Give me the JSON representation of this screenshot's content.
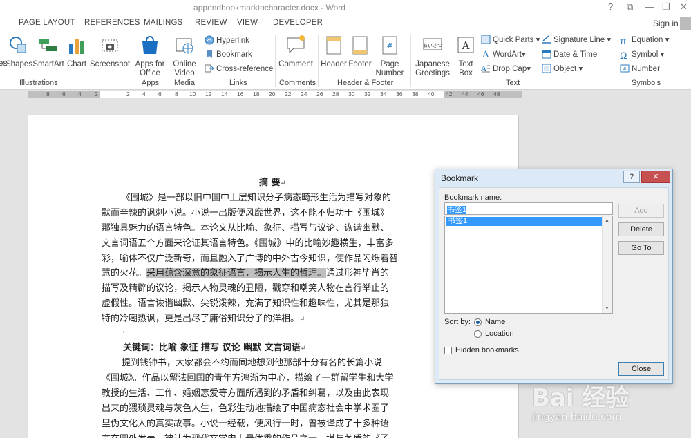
{
  "window": {
    "title": "appendbookmarktocharacter.docx - Word",
    "controls": [
      "?",
      "⧉",
      "—",
      "❐",
      "✕"
    ]
  },
  "tabs": [
    "PAGE LAYOUT",
    "REFERENCES",
    "MAILINGS",
    "REVIEW",
    "VIEW",
    "DEVELOPER"
  ],
  "signin": "Sign in",
  "ribbon": {
    "illustrations": {
      "label": "Illustrations",
      "cut": "es",
      "shapes": "Shapes",
      "smartart": "SmartArt",
      "chart": "Chart",
      "screenshot": "Screenshot"
    },
    "apps": {
      "label": "Apps",
      "apps_for_office_1": "Apps for",
      "apps_for_office_2": "Office"
    },
    "media": {
      "label": "Media",
      "online_video_1": "Online",
      "online_video_2": "Video"
    },
    "links": {
      "label": "Links",
      "hyperlink": "Hyperlink",
      "bookmark": "Bookmark",
      "cross_reference": "Cross-reference"
    },
    "comments": {
      "label": "Comments",
      "comment": "Comment"
    },
    "header_footer": {
      "label": "Header & Footer",
      "header": "Header",
      "footer": "Footer",
      "page_number_1": "Page",
      "page_number_2": "Number"
    },
    "text": {
      "label": "Text",
      "japanese_1": "Japanese",
      "japanese_2": "Greetings",
      "textbox_1": "Text",
      "textbox_2": "Box",
      "quick_parts": "Quick Parts",
      "wordart": "WordArt",
      "drop_cap": "Drop Cap",
      "signature_line": "Signature Line",
      "date_time": "Date & Time",
      "object": "Object"
    },
    "symbols": {
      "label": "Symbols",
      "equation": "Equation",
      "symbol": "Symbol",
      "number": "Number"
    }
  },
  "ruler": [
    "8",
    "6",
    "4",
    "2",
    "2",
    "4",
    "6",
    "8",
    "10",
    "12",
    "14",
    "16",
    "18",
    "20",
    "22",
    "24",
    "26",
    "28",
    "30",
    "32",
    "34",
    "36",
    "38",
    "40",
    "42",
    "44",
    "46",
    "48"
  ],
  "document": {
    "title": "摘  要",
    "lines": [
      "《围城》是一部以旧中国中上层知识分子病态畸形生活为描写对象的",
      "默而辛辣的讽刺小说。小说一出版便风靡世界，这不能不归功于《围城》",
      "那独具魅力的语言特色。本论文从比喻、象征、描写与议论、诙谐幽默、",
      "文言词语五个方面来论证其语言特色。《围城》中的比喻妙趣横生，丰富多",
      "彩，喻体不仅广泛新奇，而且融入了广博的中外古今知识，使作品闪烁着智"
    ],
    "line6_pre": "慧的火花。",
    "line6_highlight": "采用蕴含深意的象征语言，揭示人生的哲理。",
    "line6_post": "通过形神毕肖的",
    "lines2": [
      "描写及精辟的议论，揭示人物灵魂的丑陋，戳穿和嘲笑人物在言行举止的",
      "虚假性。语言诙谐幽默、尖锐泼辣，充满了知识性和趣味性，尤其是那独",
      "特的冷嘲热讽，更是出尽了庸俗知识分子的洋相。"
    ],
    "keywords": "关键词：比喻   象征   描写   议论   幽默   文言词语",
    "lines3": [
      "提到钱钟书，大家都会不约而同地想到他那部十分有名的长篇小说",
      "《围城》。作品以留法回国的青年方鸿渐为中心，描绘了一群留学生和大学",
      "教授的生活、工作、婚姻恋爱等方面所遇到的矛盾和纠葛，以及由此表现",
      "出来的猥琐灵魂与灰色人生，色彩生动地描绘了中国病态社会中学术圈子",
      "里伪文化人的真实故事。小说一经载，便风行一时，曾被译成了十多种语",
      "言在国外发表，被认为现代文学史上最优秀的作品之一，堪与茅盾的《子"
    ]
  },
  "dialog": {
    "title": "Bookmark",
    "help": "?",
    "close_x": "✕",
    "name_label": "Bookmark name:",
    "name_value": "书签1",
    "items": [
      "书签1"
    ],
    "add": "Add",
    "delete": "Delete",
    "goto": "Go To",
    "sort_by": "Sort by:",
    "sort_name": "Name",
    "sort_location": "Location",
    "hidden": "Hidden bookmarks",
    "close": "Close"
  },
  "watermark": {
    "main": "Bai 经验",
    "sub": "jingyan.baidu.com"
  }
}
